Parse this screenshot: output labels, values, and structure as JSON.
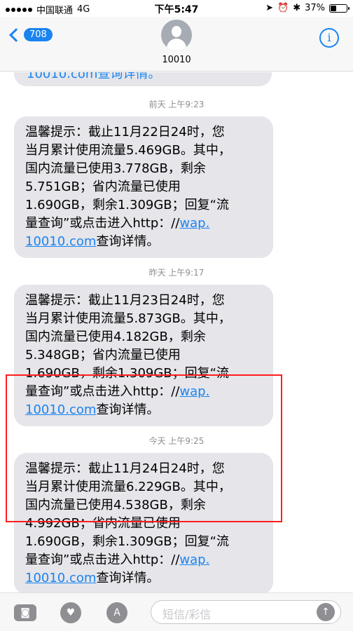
{
  "status_bar": {
    "carrier": "中国联通",
    "network": "4G",
    "time": "下午5:47",
    "battery_text": "37%",
    "battery_level": 0.37
  },
  "nav": {
    "back_count": "708",
    "contact_name": "10010",
    "info_label": "i"
  },
  "thread": {
    "previous_snippet": "10010.com查询详情。",
    "messages": [
      {
        "timestamp": "前天 上午9:23",
        "text": "温馨提示：截止11月22日24时，您\n当月累计使用流量5.469GB。其中，\n国内流量已使用3.778GB，剩余\n5.751GB；省内流量已使用\n1.690GB，剩余1.309GB；回复“流\n量查询”或点击进入http：//",
        "link_a": "wap.",
        "link_b": "10010.com",
        "suffix": "查询详情。"
      },
      {
        "timestamp": "昨天 上午9:17",
        "text": "温馨提示：截止11月23日24时，您\n当月累计使用流量5.873GB。其中，\n国内流量已使用4.182GB，剩余\n5.348GB；省内流量已使用\n1.690GB，剩余1.309GB；回复“流\n量查询”或点击进入http：//",
        "link_a": "wap.",
        "link_b": "10010.com",
        "suffix": "查询详情。"
      },
      {
        "timestamp": "今天 上午9:25",
        "text": "温馨提示：截止11月24日24时，您\n当月累计使用流量6.229GB。其中，\n国内流量已使用4.538GB，剩余\n4.992GB；省内流量已使用\n1.690GB，剩余1.309GB；回复“流\n量查询”或点击进入http：//",
        "link_a": "wap.",
        "link_b": "10010.com",
        "suffix": "查询详情。"
      }
    ]
  },
  "toolbar": {
    "input_placeholder": "短信/彩信",
    "icons": [
      "camera-icon",
      "heart-icon",
      "app-store-icon",
      "send-arrow-icon"
    ]
  },
  "colors": {
    "link_blue": "#1a84f0",
    "bubble_grey": "#e5e5ea",
    "highlight_red": "#ff1e1e"
  }
}
